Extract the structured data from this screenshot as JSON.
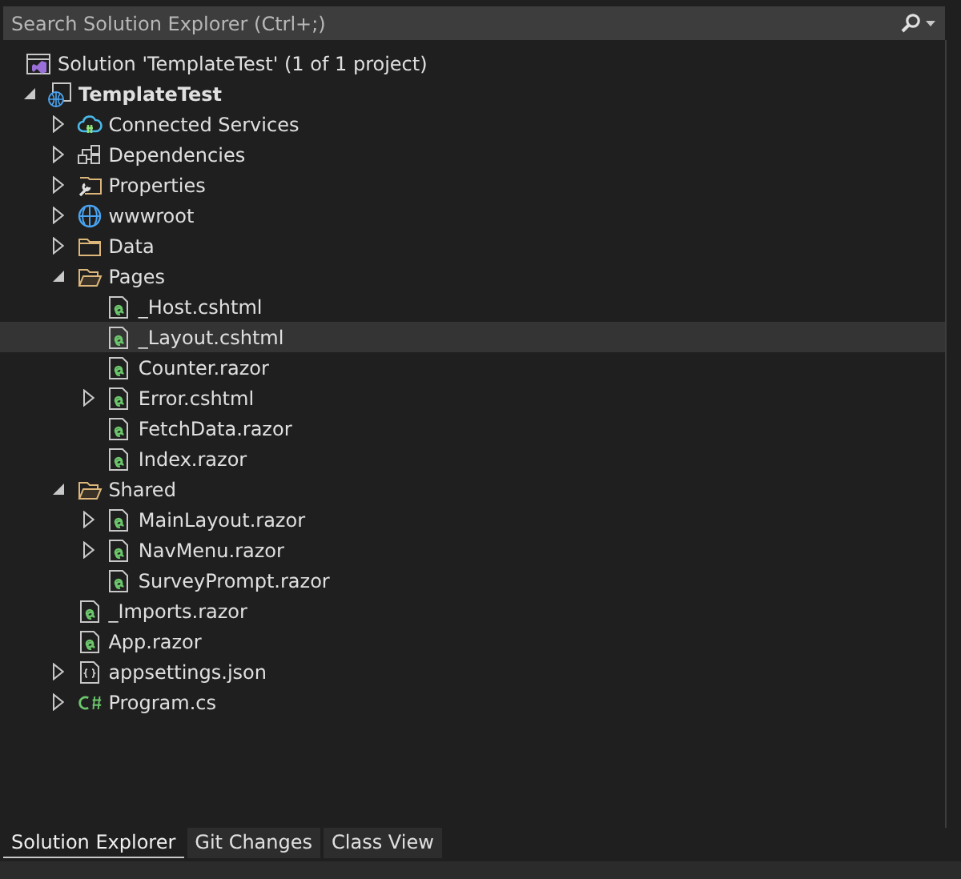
{
  "search": {
    "placeholder": "Search Solution Explorer (Ctrl+;)"
  },
  "solution": {
    "label": "Solution 'TemplateTest' (1 of 1 project)"
  },
  "project": {
    "label": "TemplateTest",
    "expanded": true,
    "selected": false,
    "children": [
      {
        "label": "Connected Services",
        "kind": "connected",
        "expanded": false,
        "selected": false
      },
      {
        "label": "Dependencies",
        "kind": "dependencies",
        "expanded": false,
        "selected": false
      },
      {
        "label": "Properties",
        "kind": "properties",
        "expanded": false,
        "selected": false
      },
      {
        "label": "wwwroot",
        "kind": "globe",
        "expanded": false,
        "selected": false
      },
      {
        "label": "Data",
        "kind": "folder",
        "expanded": false,
        "selected": false
      },
      {
        "label": "Pages",
        "kind": "folder",
        "expanded": true,
        "selected": false,
        "children": [
          {
            "label": "_Host.cshtml",
            "kind": "razor",
            "selected": false
          },
          {
            "label": "_Layout.cshtml",
            "kind": "razor",
            "selected": true
          },
          {
            "label": "Counter.razor",
            "kind": "razor",
            "selected": false
          },
          {
            "label": "Error.cshtml",
            "kind": "razor",
            "expanded": false,
            "selected": false
          },
          {
            "label": "FetchData.razor",
            "kind": "razor",
            "selected": false
          },
          {
            "label": "Index.razor",
            "kind": "razor",
            "selected": false
          }
        ]
      },
      {
        "label": "Shared",
        "kind": "folder",
        "expanded": true,
        "selected": false,
        "children": [
          {
            "label": "MainLayout.razor",
            "kind": "razor",
            "expanded": false,
            "selected": false
          },
          {
            "label": "NavMenu.razor",
            "kind": "razor",
            "expanded": false,
            "selected": false
          },
          {
            "label": "SurveyPrompt.razor",
            "kind": "razor",
            "selected": false
          }
        ]
      },
      {
        "label": "_Imports.razor",
        "kind": "razor",
        "selected": false
      },
      {
        "label": "App.razor",
        "kind": "razor",
        "selected": false
      },
      {
        "label": "appsettings.json",
        "kind": "json",
        "expanded": false,
        "selected": false
      },
      {
        "label": "Program.cs",
        "kind": "csharp",
        "expanded": false,
        "selected": false
      }
    ]
  },
  "tabs": [
    {
      "label": "Solution Explorer",
      "selected": true
    },
    {
      "label": "Git Changes",
      "selected": false
    },
    {
      "label": "Class View",
      "selected": false
    }
  ]
}
